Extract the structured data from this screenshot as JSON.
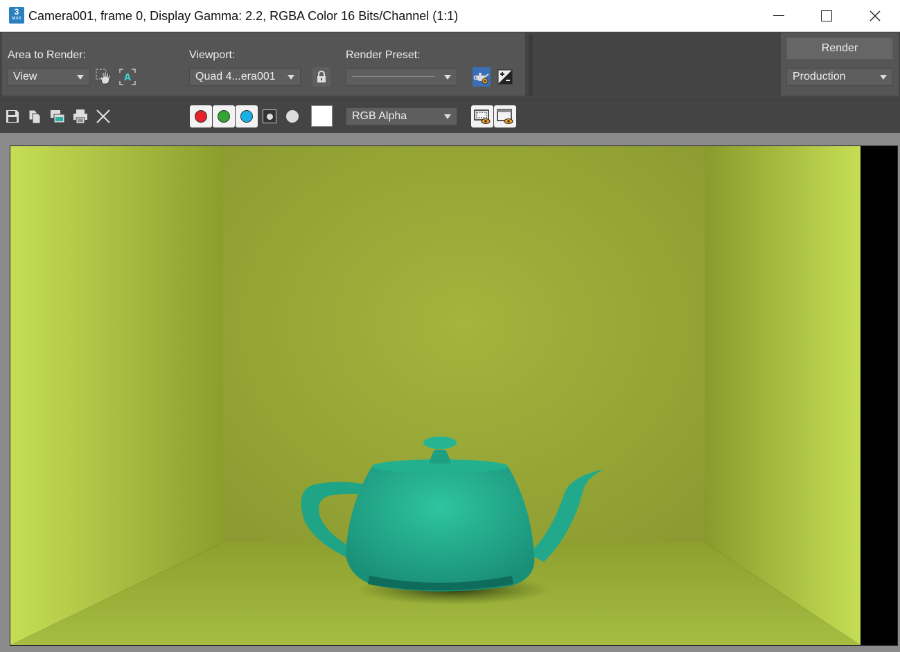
{
  "window": {
    "title": "Camera001, frame 0, Display Gamma: 2.2, RGBA Color 16 Bits/Channel (1:1)",
    "app_icon_text": "3",
    "app_icon_sub": "MAX"
  },
  "toolbar": {
    "area_label": "Area to Render:",
    "area_value": "View",
    "viewport_label": "Viewport:",
    "viewport_value": "Quad 4...era001",
    "preset_label": "Render Preset:",
    "preset_value": "",
    "render_button": "Render",
    "render_mode": "Production"
  },
  "toolbar2": {
    "channel_select": "RGB Alpha",
    "colors": {
      "red": "#e3242b",
      "green": "#33a532",
      "blue": "#1ab0e8"
    }
  },
  "colors": {
    "panel": "#555555",
    "background": "#444444",
    "wall": "#a4b43c",
    "teapot": "#27b493"
  }
}
